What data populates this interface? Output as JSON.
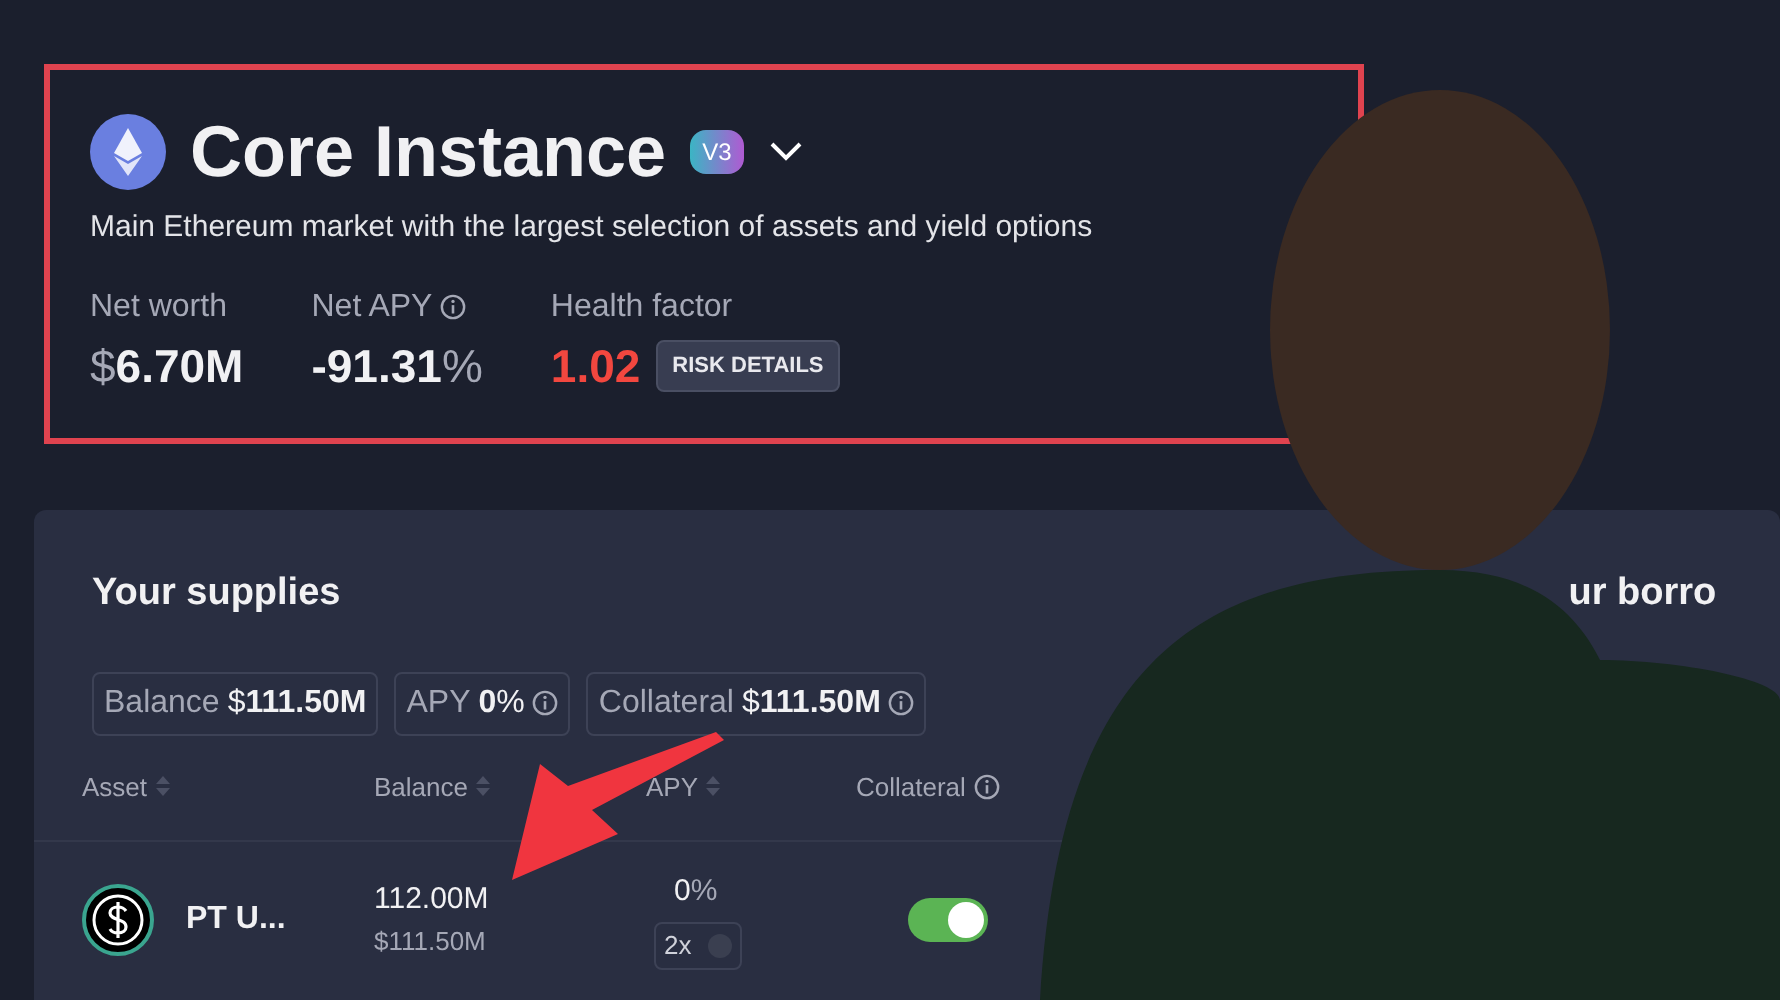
{
  "market": {
    "title": "Core Instance",
    "version": "V3",
    "description": "Main Ethereum market with the largest selection of assets and yield options",
    "stats": [
      {
        "label": "Net worth",
        "currency": "$",
        "value": "6.70M",
        "kind": "plain",
        "info": false
      },
      {
        "label": "Net APY",
        "value": "-91.31",
        "suffix": "%",
        "kind": "plain",
        "info": true
      },
      {
        "label": "Health factor",
        "value": "1.02",
        "kind": "health",
        "info": false,
        "button": "RISK DETAILS"
      }
    ]
  },
  "supplies": {
    "title": "Your supplies",
    "summary": [
      {
        "label": "Balance",
        "currency": "$",
        "value": "111.50M",
        "info": false
      },
      {
        "label": "APY",
        "value": "0",
        "suffix": "%",
        "info": true
      },
      {
        "label": "Collateral",
        "currency": "$",
        "value": "111.50M",
        "info": true
      }
    ],
    "columns": [
      {
        "label": "Asset",
        "sortable": true,
        "info": false
      },
      {
        "label": "Balance",
        "sortable": true,
        "info": false
      },
      {
        "label": "APY",
        "sortable": true,
        "info": false
      },
      {
        "label": "Collateral",
        "sortable": false,
        "info": true
      }
    ],
    "rows": [
      {
        "asset": "PT U...",
        "balance": "112.00M",
        "balance_usd": "$111.50M",
        "apy": "0",
        "apy_suffix": "%",
        "multiplier": "2x",
        "collateral": true
      }
    ]
  },
  "borrows": {
    "title": "ur borro"
  }
}
